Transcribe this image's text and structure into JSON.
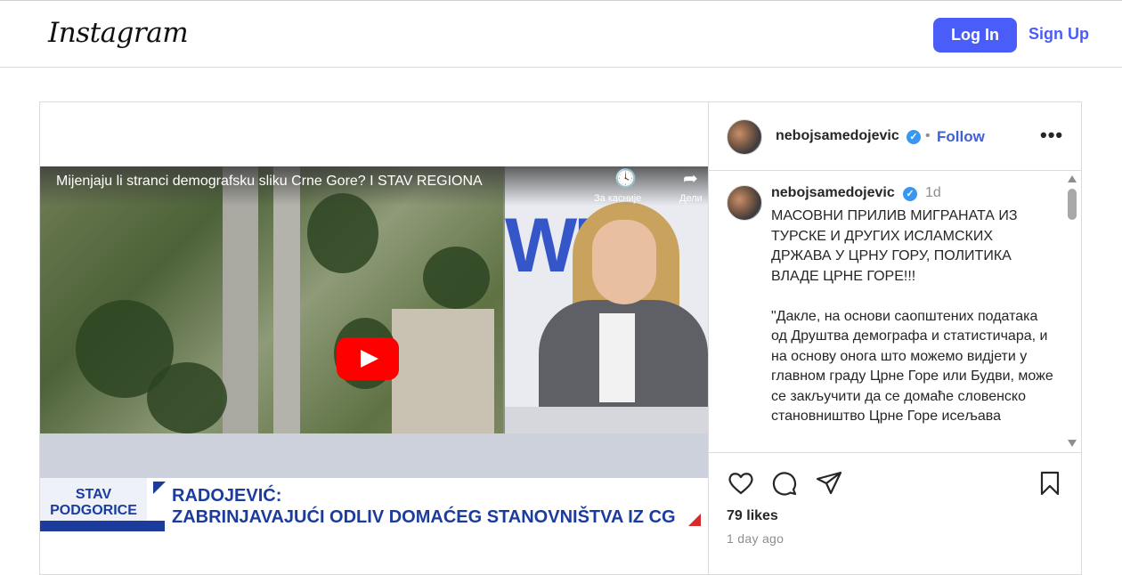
{
  "nav": {
    "logo": "Instagram",
    "login_label": "Log In",
    "signup_label": "Sign Up",
    "accent_color": "#4a5df9"
  },
  "video": {
    "title": "Mijenjaju li stranci demografsku sliku Crne Gore? I STAV REGIONA",
    "watch_later_label": "За касније",
    "share_label": "Дели",
    "studio_logo_text": "WM",
    "lower_third": {
      "show_name": "STAV\nPODGORICE",
      "headline_line1": "RADOJEVIĆ:",
      "headline_line2": "ZABRINJAVAJUĆI ODLIV DOMAĆEG STANOVNIŠTVA IZ CG"
    }
  },
  "post": {
    "username": "nebojsamedojevic",
    "follow_label": "Follow",
    "separator": "•",
    "more_icon": "more-horizontal-icon",
    "time_short": "1d",
    "caption": "МАСОВНИ ПРИЛИВ МИГРАНАТА ИЗ ТУРСКЕ И ДРУГИХ ИСЛАМСКИХ ДРЖАВА У ЦРНУ ГОРУ, ПОЛИТИКА ВЛАДЕ ЦРНЕ ГОРЕ!!!\n\n\"Дакле, на основи саопштених података од Друштва демографа и статистичара, и на основу онога што можемо видјети у главном граду Црне Горе или Будви, може се закључити да се домаће словенско становништво Црне Горе исељава",
    "likes": "79 likes",
    "time_ago": "1 day ago",
    "verified_color": "#3897f0"
  }
}
